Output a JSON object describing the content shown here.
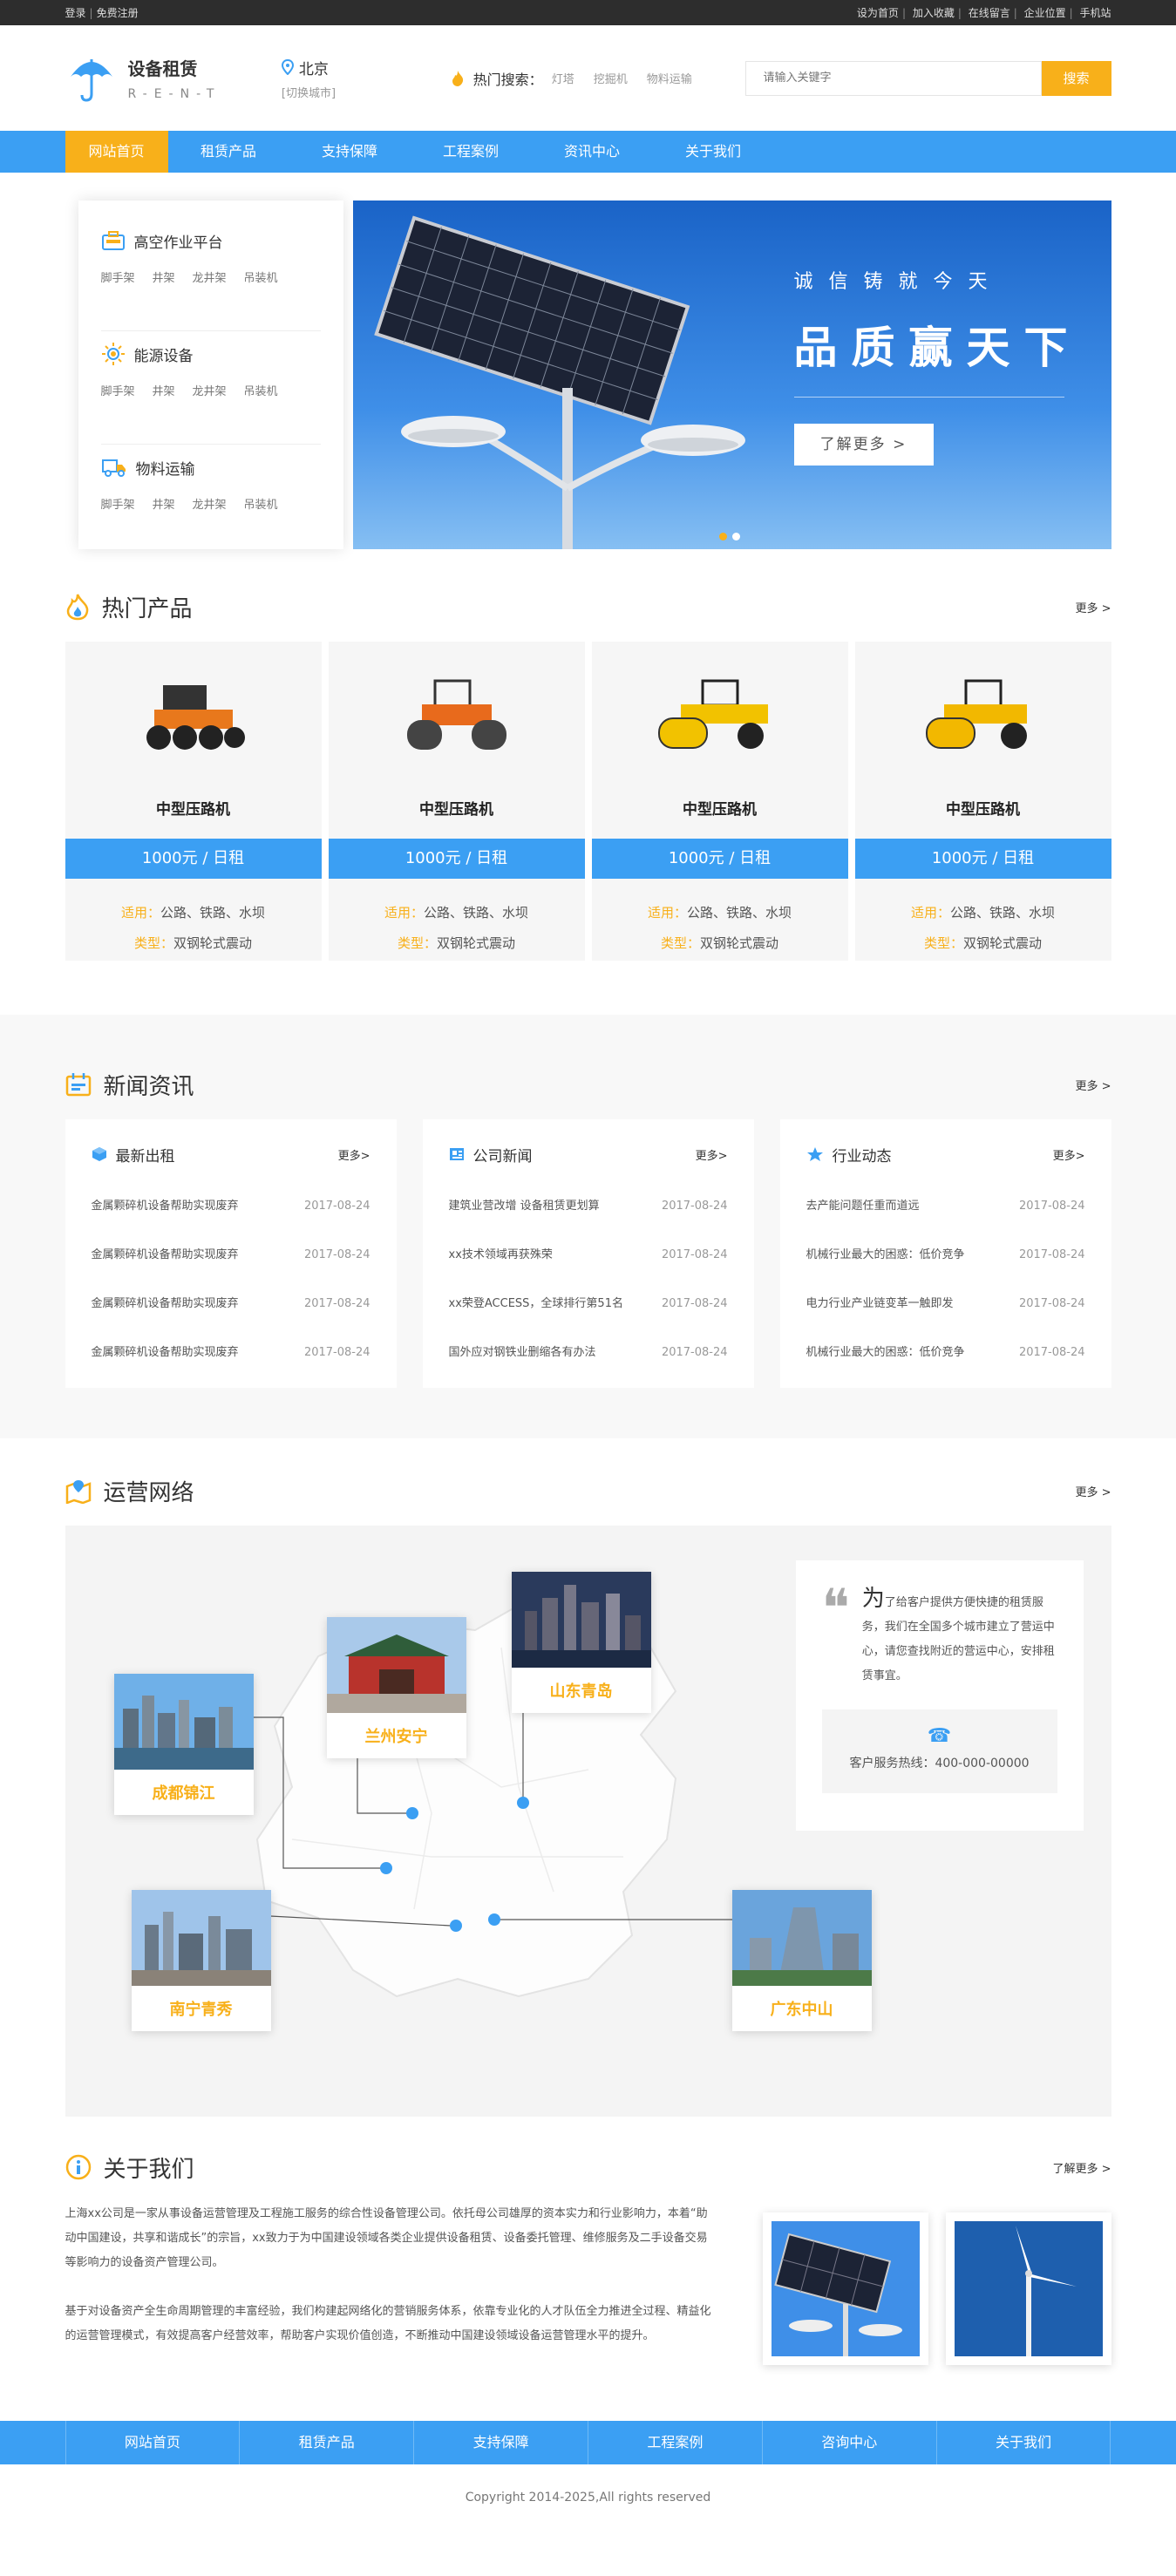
{
  "topbar": {
    "login": "登录",
    "register": "免费注册",
    "links": [
      "设为首页",
      "加入收藏",
      "在线留言",
      "企业位置",
      "手机站"
    ]
  },
  "header": {
    "logo_title": "设备租赁",
    "logo_sub": "R-E-N-T",
    "city": "北京",
    "city_switch": "[切换城市]",
    "hot_label": "热门搜索：",
    "hot_items": [
      "灯塔",
      "挖掘机",
      "物料运输"
    ],
    "search_placeholder": "请输入关键字",
    "search_button": "搜索"
  },
  "nav": [
    "网站首页",
    "租赁产品",
    "支持保障",
    "工程案例",
    "资讯中心",
    "关于我们"
  ],
  "categories": [
    {
      "title": "高空作业平台",
      "items": [
        "脚手架",
        "井架",
        "龙井架",
        "吊装机"
      ]
    },
    {
      "title": "能源设备",
      "items": [
        "脚手架",
        "井架",
        "龙井架",
        "吊装机"
      ]
    },
    {
      "title": "物料运输",
      "items": [
        "脚手架",
        "井架",
        "龙井架",
        "吊装机"
      ]
    }
  ],
  "banner": {
    "small": "诚信铸就今天",
    "big": "品质赢天下",
    "button": "了解更多 >"
  },
  "products": {
    "title": "热门产品",
    "more": "更多 >",
    "use_key": "适用：",
    "type_key": "类型：",
    "items": [
      {
        "name": "中型压路机",
        "price": "1000元 / 日租",
        "use": "公路、铁路、水坝",
        "type": "双钢轮式震动",
        "color": "#e8781c"
      },
      {
        "name": "中型压路机",
        "price": "1000元 / 日租",
        "use": "公路、铁路、水坝",
        "type": "双钢轮式震动",
        "color": "#e86a1c"
      },
      {
        "name": "中型压路机",
        "price": "1000元 / 日租",
        "use": "公路、铁路、水坝",
        "type": "双钢轮式震动",
        "color": "#f2c200"
      },
      {
        "name": "中型压路机",
        "price": "1000元 / 日租",
        "use": "公路、铁路、水坝",
        "type": "双钢轮式震动",
        "color": "#f2b800"
      }
    ]
  },
  "news": {
    "title": "新闻资讯",
    "more": "更多 >",
    "cols": [
      {
        "title": "最新出租",
        "more": "更多>",
        "rows": [
          {
            "t": "金属颗碎机设备帮助实现废弃",
            "d": "2017-08-24"
          },
          {
            "t": "金属颗碎机设备帮助实现废弃",
            "d": "2017-08-24"
          },
          {
            "t": "金属颗碎机设备帮助实现废弃",
            "d": "2017-08-24"
          },
          {
            "t": "金属颗碎机设备帮助实现废弃",
            "d": "2017-08-24"
          }
        ]
      },
      {
        "title": "公司新闻",
        "more": "更多>",
        "rows": [
          {
            "t": "建筑业营改增 设备租赁更划算",
            "d": "2017-08-24"
          },
          {
            "t": "xx技术领域再获殊荣",
            "d": "2017-08-24"
          },
          {
            "t": "xx荣登ACCESS，全球排行第51名",
            "d": "2017-08-24"
          },
          {
            "t": "国外应对钢铁业删缩各有办法",
            "d": "2017-08-24"
          }
        ]
      },
      {
        "title": "行业动态",
        "more": "更多>",
        "rows": [
          {
            "t": "去产能问题任重而道远",
            "d": "2017-08-24"
          },
          {
            "t": "机械行业最大的困惑：低价竞争",
            "d": "2017-08-24"
          },
          {
            "t": "电力行业产业链变革一触即发",
            "d": "2017-08-24"
          },
          {
            "t": "机械行业最大的困惑：低价竞争",
            "d": "2017-08-24"
          }
        ]
      }
    ]
  },
  "network": {
    "title": "运营网络",
    "more": "更多 >",
    "cities": [
      "成都锦江",
      "兰州安宁",
      "山东青岛",
      "南宁青秀",
      "广东中山"
    ],
    "quote_lead": "为",
    "quote_text": "了给客户提供方便快捷的租赁服务，我们在全国多个城市建立了营运中心，请您查找附近的营运中心，安排租赁事宜。",
    "hotline": "客户服务热线：400-000-00000"
  },
  "about": {
    "title": "关于我们",
    "more": "了解更多 >",
    "p1": "上海xx公司是一家从事设备运营管理及工程施工服务的综合性设备管理公司。依托母公司雄厚的资本实力和行业影响力，本着“助动中国建设，共享和谐成长”的宗旨，xx致力于为中国建设领域各类企业提供设备租赁、设备委托管理、维修服务及二手设备交易等影响力的设备资产管理公司。",
    "p2": "基于对设备资产全生命周期管理的丰富经验，我们构建起网络化的营销服务体系，依靠专业化的人才队伍全力推进全过程、精益化的运营管理模式，有效提高客户经营效率，帮助客户实现价值创造，不断推动中国建设领域设备运营管理水平的提升。"
  },
  "footer": {
    "nav": [
      "网站首页",
      "租赁产品",
      "支持保障",
      "工程案例",
      "咨询中心",
      "关于我们"
    ],
    "copyright": "Copyright  2014-2025,All rights reserved"
  }
}
